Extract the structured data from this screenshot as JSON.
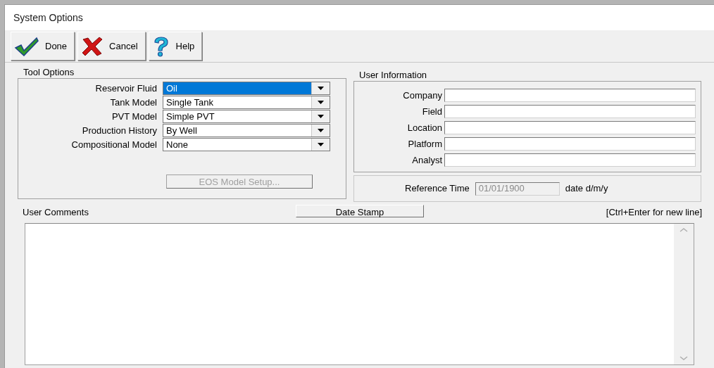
{
  "window": {
    "title": "System Options"
  },
  "toolbar": [
    {
      "kind": "done",
      "label": "Done"
    },
    {
      "kind": "cancel",
      "label": "Cancel"
    },
    {
      "kind": "help",
      "label": "Help"
    }
  ],
  "tool_options": {
    "title": "Tool Options",
    "fields": [
      {
        "label": "Reservoir Fluid",
        "value": "Oil",
        "highlighted": true
      },
      {
        "label": "Tank Model",
        "value": "Single Tank",
        "highlighted": false
      },
      {
        "label": "PVT Model",
        "value": "Simple PVT",
        "highlighted": false
      },
      {
        "label": "Production History",
        "value": "By Well",
        "highlighted": false
      },
      {
        "label": "Compositional Model",
        "value": "None",
        "highlighted": false
      }
    ],
    "eos_button": {
      "label": "EOS Model Setup...",
      "disabled": true
    }
  },
  "user_information": {
    "title": "User Information",
    "fields": [
      {
        "label": "Company"
      },
      {
        "label": "Field"
      },
      {
        "label": "Location"
      },
      {
        "label": "Platform"
      },
      {
        "label": "Analyst"
      }
    ]
  },
  "reference_time": {
    "label": "Reference Time",
    "value": "01/01/1900",
    "disabled": true,
    "unit": "date d/m/y"
  },
  "comments": {
    "title": "User Comments",
    "date_stamp": "Date Stamp",
    "hint": "[Ctrl+Enter for new line]"
  }
}
